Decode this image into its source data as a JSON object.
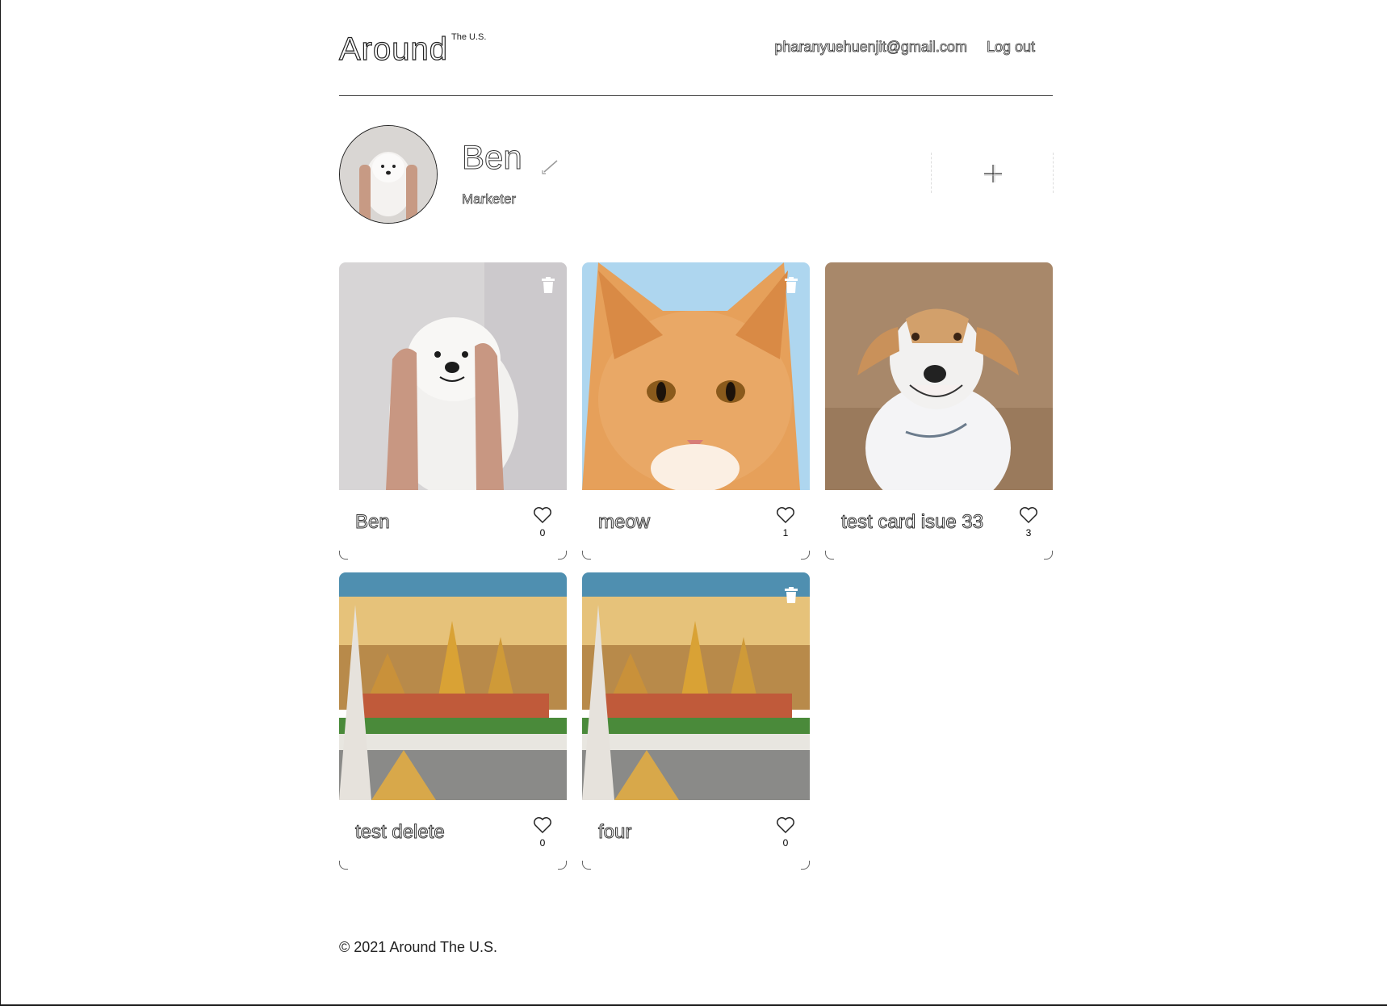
{
  "header": {
    "logo": "Around",
    "logo_sup": "The U.S.",
    "email": "pharanyuehuenjit@gmail.com",
    "logout": "Log out"
  },
  "profile": {
    "name": "Ben",
    "job": "Marketer"
  },
  "cards": [
    {
      "title": "Ben",
      "likes": "0",
      "deletable": true,
      "image": "samoyed-dog"
    },
    {
      "title": "meow",
      "likes": "1",
      "deletable": true,
      "image": "orange-cat"
    },
    {
      "title": "test card isue 33",
      "likes": "3",
      "deletable": false,
      "image": "smiling-dog"
    },
    {
      "title": "test delete",
      "likes": "0",
      "deletable": false,
      "image": "bangkok-temple"
    },
    {
      "title": "four",
      "likes": "0",
      "deletable": true,
      "image": "bangkok-temple"
    }
  ],
  "footer": {
    "copyright": "© 2021 Around The U.S."
  }
}
